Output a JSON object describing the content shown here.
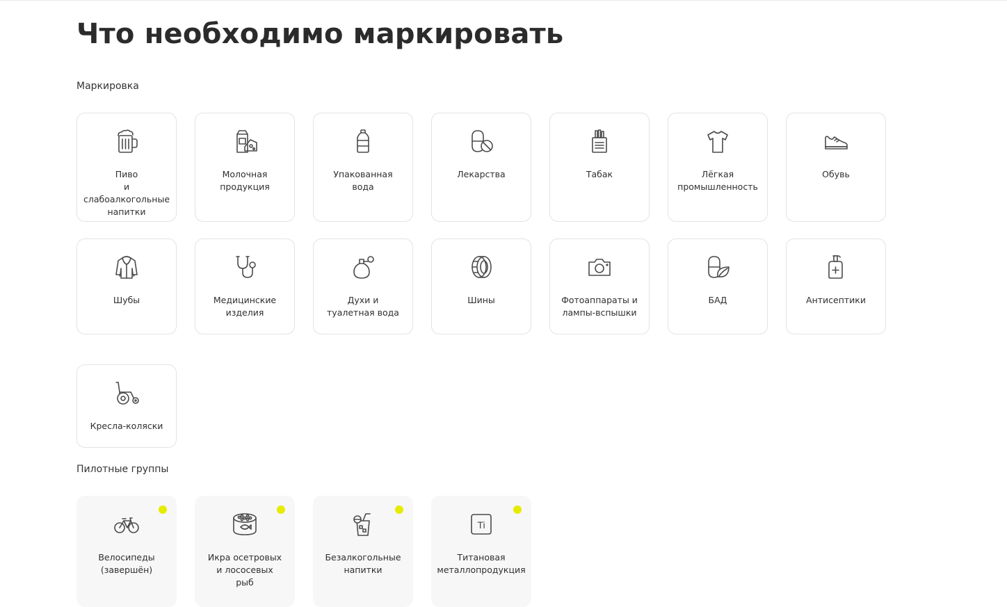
{
  "page": {
    "title": "Что необходимо маркировать"
  },
  "sections": {
    "marking": {
      "label": "Маркировка",
      "items": [
        {
          "label": "Пиво\nи слабоалкогольные\nнапитки",
          "icon": "beer-mug-icon"
        },
        {
          "label": "Молочная\nпродукция",
          "icon": "milk-cheese-icon"
        },
        {
          "label": "Упакованная\nвода",
          "icon": "water-bottle-icon"
        },
        {
          "label": "Лекарства",
          "icon": "pills-icon"
        },
        {
          "label": "Табак",
          "icon": "cigarettes-icon"
        },
        {
          "label": "Лёгкая\nпромышленность",
          "icon": "tshirt-icon"
        },
        {
          "label": "Обувь",
          "icon": "sneaker-icon"
        },
        {
          "label": "Шубы",
          "icon": "fur-coat-icon"
        },
        {
          "label": "Медицинские\nизделия",
          "icon": "stethoscope-icon"
        },
        {
          "label": "Духи и\nтуалетная вода",
          "icon": "perfume-icon"
        },
        {
          "label": "Шины",
          "icon": "tire-icon"
        },
        {
          "label": "Фотоаппараты и\nлампы-вспышки",
          "icon": "camera-icon"
        },
        {
          "label": "БАД",
          "icon": "supplement-leaf-icon"
        },
        {
          "label": "Антисептики",
          "icon": "sanitizer-icon"
        },
        {
          "label": "Кресла-коляски",
          "icon": "wheelchair-icon"
        }
      ]
    },
    "pilot": {
      "label": "Пилотные группы",
      "dot_color": "#e6ec00",
      "items": [
        {
          "label": "Велосипеды\n(завершён)",
          "icon": "bicycle-icon"
        },
        {
          "label": "Икра осетровых\nи лососевых\nрыб",
          "icon": "caviar-can-icon"
        },
        {
          "label": "Безалкогольные\nнапитки",
          "icon": "soft-drink-icon"
        },
        {
          "label": "Титановая\nметаллопродукция",
          "icon": "titanium-icon"
        }
      ]
    }
  },
  "colors": {
    "text": "#2b2b2b",
    "icon_stroke": "#4a4a4a",
    "card_border": "#e3e3e3",
    "pilot_bg": "#f7f7f7",
    "accent_dot": "#e6ec00"
  }
}
